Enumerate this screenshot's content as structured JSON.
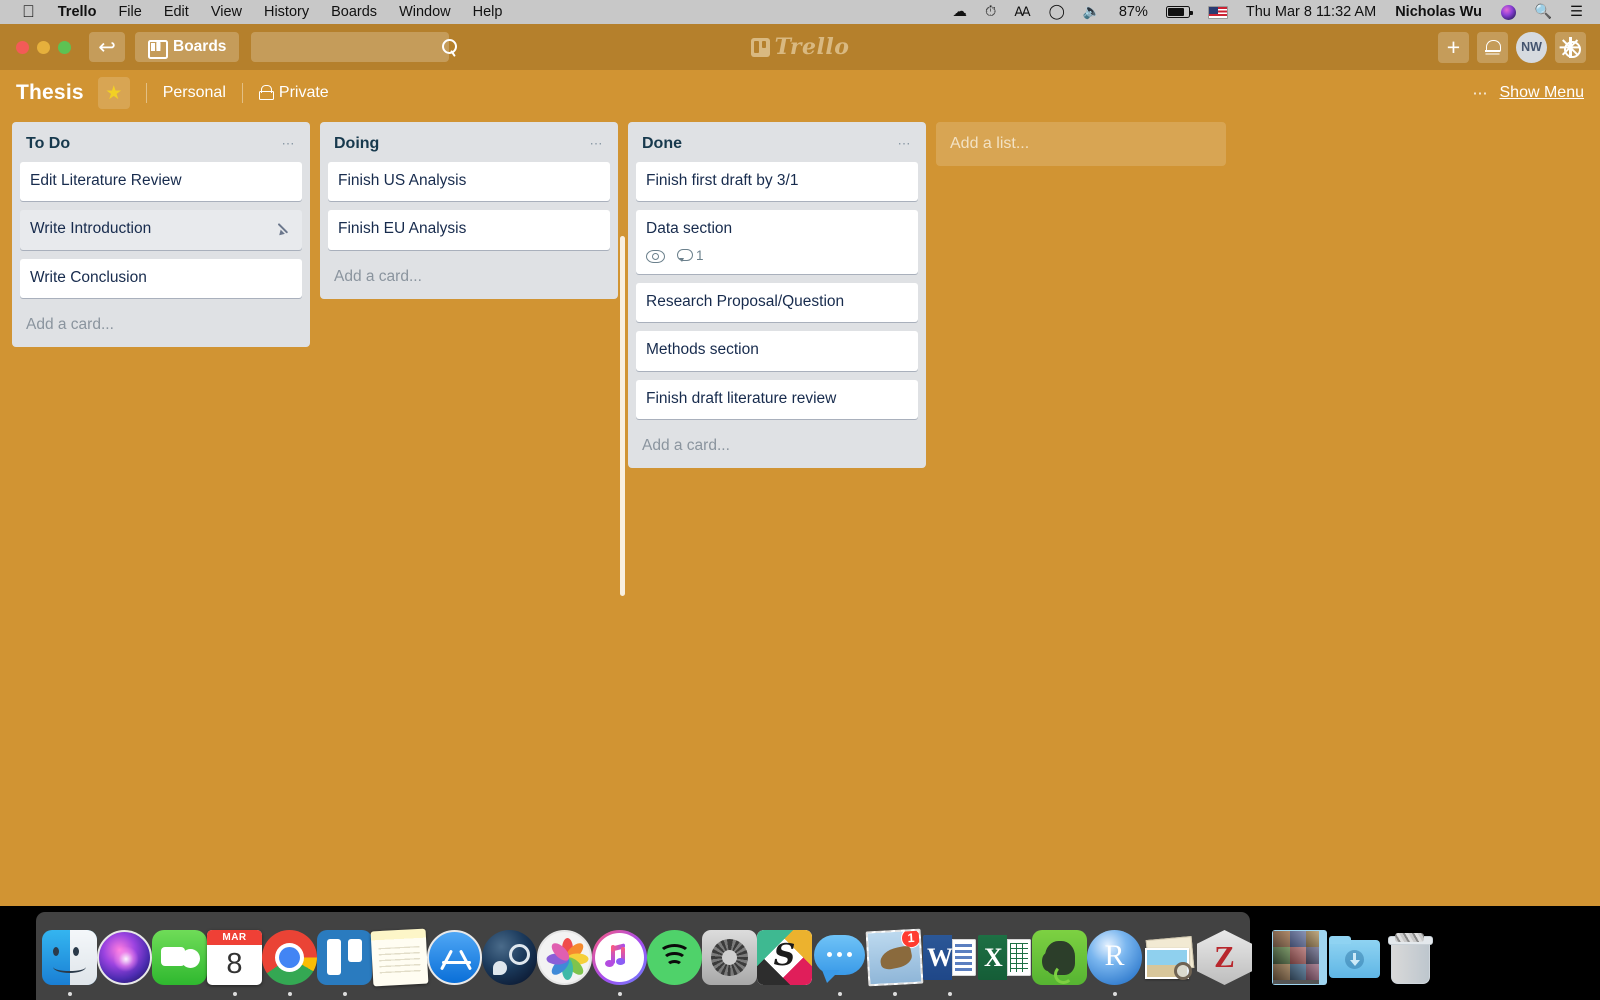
{
  "menubar": {
    "apple_icon": "apple-icon",
    "items": [
      {
        "label": "Trello",
        "bold": true
      },
      {
        "label": "File",
        "bold": false
      },
      {
        "label": "Edit",
        "bold": false
      },
      {
        "label": "View",
        "bold": false
      },
      {
        "label": "History",
        "bold": false
      },
      {
        "label": "Boards",
        "bold": false
      },
      {
        "label": "Window",
        "bold": false
      },
      {
        "label": "Help",
        "bold": false
      }
    ],
    "status": {
      "battery_percent": "87%",
      "datetime": "Thu Mar 8  11:32 AM",
      "user_name": "Nicholas Wu",
      "icons": [
        "cloud-upload-icon",
        "time-machine-icon",
        "bluetooth-icon",
        "wifi-icon",
        "volume-icon",
        "battery-icon",
        "us-flag-icon",
        "siri-icon",
        "spotlight-search-icon",
        "control-center-icon"
      ]
    }
  },
  "trello_header": {
    "back_icon": "back-arrow-icon",
    "boards_label": "Boards",
    "boards_icon": "board-grid-icon",
    "search_placeholder": "",
    "search_value": "",
    "search_icon": "search-icon",
    "logo_text": "Trello",
    "add_icon": "plus-icon",
    "notifications_icon": "bell-icon",
    "avatar_initials": "NW",
    "settings_icon": "gear-icon"
  },
  "board_header": {
    "title": "Thesis",
    "star_icon": "star-icon",
    "team": "Personal",
    "visibility": "Private",
    "visibility_icon": "lock-icon",
    "overflow_icon": "ellipsis-icon",
    "show_menu": "Show Menu"
  },
  "board": {
    "background_color": "#d19433",
    "header_color": "#b5802c",
    "list_bg_color": "#dfe1e4",
    "add_list_label": "Add a list...",
    "add_card_label": "Add a card...",
    "lists": [
      {
        "title": "To Do",
        "cards": [
          {
            "text": "Edit Literature Review",
            "hovered": false,
            "badges": []
          },
          {
            "text": "Write Introduction",
            "hovered": true,
            "edit_icon": "pencil-icon",
            "badges": []
          },
          {
            "text": "Write Conclusion",
            "hovered": false,
            "badges": []
          }
        ]
      },
      {
        "title": "Doing",
        "cards": [
          {
            "text": "Finish US Analysis",
            "hovered": false,
            "badges": []
          },
          {
            "text": "Finish EU Analysis",
            "hovered": false,
            "badges": []
          }
        ]
      },
      {
        "title": "Done",
        "cards": [
          {
            "text": "Finish first draft by 3/1",
            "hovered": false,
            "badges": []
          },
          {
            "text": "Data section",
            "hovered": false,
            "badges": [
              {
                "icon": "eye-icon",
                "value": ""
              },
              {
                "icon": "comment-icon",
                "value": "1"
              }
            ]
          },
          {
            "text": "Research Proposal/Question",
            "hovered": false,
            "badges": []
          },
          {
            "text": "Methods section",
            "hovered": false,
            "badges": []
          },
          {
            "text": "Finish draft literature review",
            "hovered": false,
            "badges": []
          }
        ]
      }
    ]
  },
  "dock": {
    "items": [
      {
        "name": "finder",
        "label": "Finder",
        "running": true
      },
      {
        "name": "siri",
        "label": "Siri",
        "running": false
      },
      {
        "name": "facetime",
        "label": "FaceTime",
        "running": false
      },
      {
        "name": "calendar",
        "label": "Calendar",
        "running": true,
        "month": "MAR",
        "day": "8"
      },
      {
        "name": "chrome",
        "label": "Google Chrome",
        "running": true
      },
      {
        "name": "trello",
        "label": "Trello",
        "running": true
      },
      {
        "name": "notes",
        "label": "Notes",
        "running": false
      },
      {
        "name": "app-store",
        "label": "App Store",
        "running": false
      },
      {
        "name": "steam",
        "label": "Steam",
        "running": false
      },
      {
        "name": "photos",
        "label": "Photos",
        "running": false
      },
      {
        "name": "itunes",
        "label": "iTunes",
        "running": true
      },
      {
        "name": "spotify",
        "label": "Spotify",
        "running": false
      },
      {
        "name": "system-preferences",
        "label": "System Preferences",
        "running": false
      },
      {
        "name": "slack",
        "label": "Slack",
        "running": false
      },
      {
        "name": "messages",
        "label": "Messages",
        "running": true
      },
      {
        "name": "mail",
        "label": "Mail",
        "running": true,
        "badge": "1"
      },
      {
        "name": "word",
        "label": "Microsoft Word",
        "running": true
      },
      {
        "name": "excel",
        "label": "Microsoft Excel",
        "running": false
      },
      {
        "name": "evernote",
        "label": "Evernote",
        "running": false
      },
      {
        "name": "r",
        "label": "R",
        "running": true
      },
      {
        "name": "preview",
        "label": "Preview",
        "running": false
      },
      {
        "name": "zotero",
        "label": "Zotero",
        "running": false
      }
    ],
    "stacks": [
      {
        "name": "photos-stack",
        "label": "Pictures"
      },
      {
        "name": "downloads-folder",
        "label": "Downloads"
      },
      {
        "name": "trash",
        "label": "Trash"
      }
    ]
  }
}
